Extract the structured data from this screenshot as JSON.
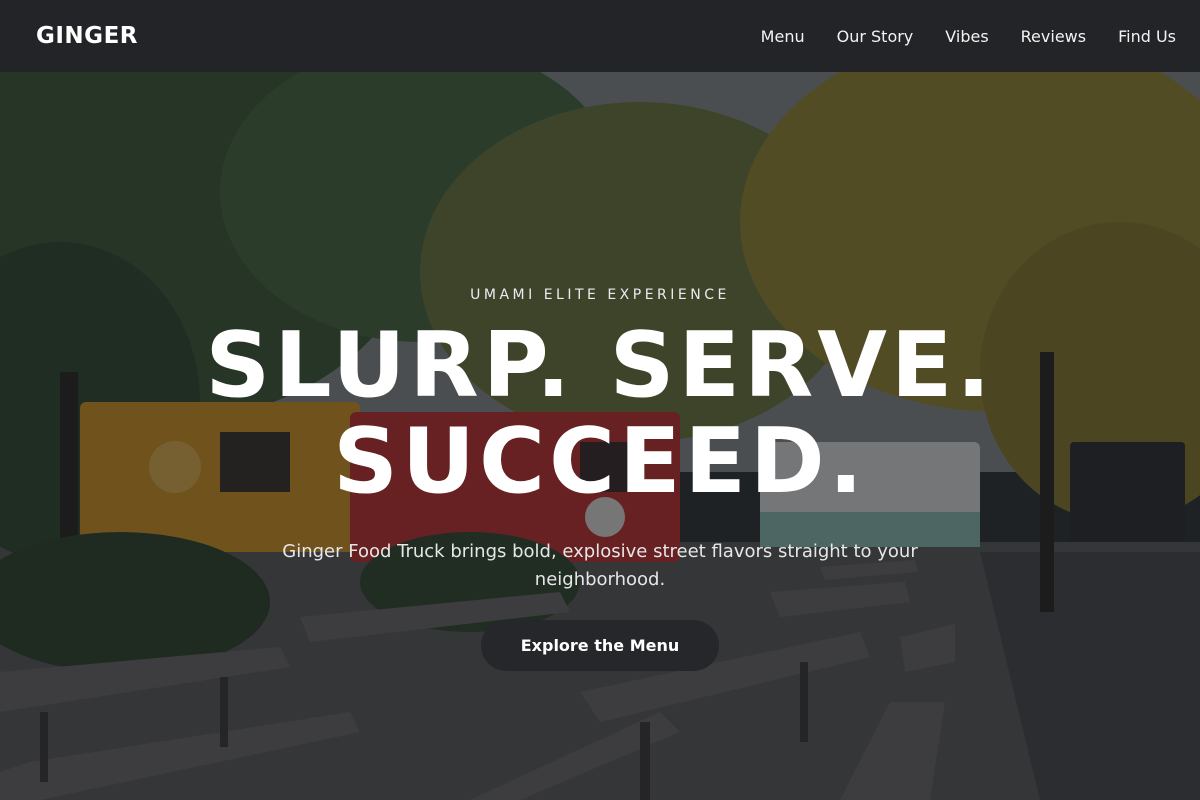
{
  "nav": {
    "brand": "GINGER",
    "links": [
      "Menu",
      "Our Story",
      "Vibes",
      "Reviews",
      "Find Us"
    ]
  },
  "hero": {
    "eyebrow": "UMAMI ELITE EXPERIENCE",
    "headline_line1": "SLURP. SERVE.",
    "headline_line2": "SUCCEED.",
    "subtext": "Ginger Food Truck brings bold, explosive street flavors straight to your neighborhood.",
    "cta_label": "Explore the Menu"
  }
}
